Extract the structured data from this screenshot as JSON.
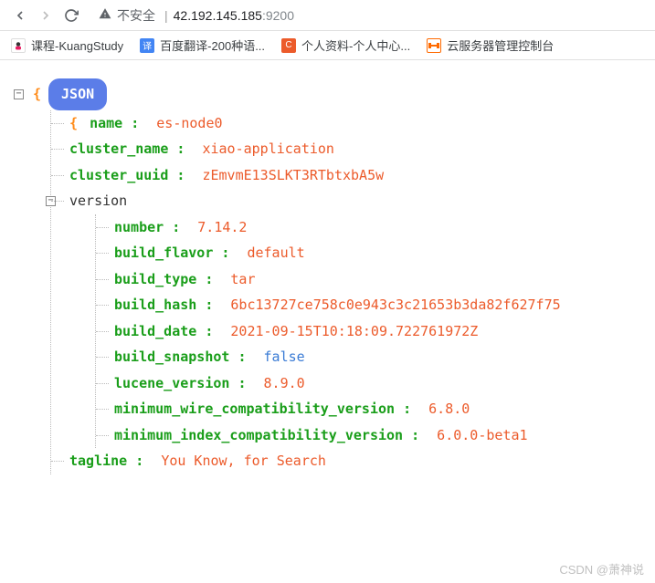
{
  "chrome": {
    "insecure_label": "不安全",
    "url_host": "42.192.145.185",
    "url_port": ":9200"
  },
  "bookmarks": [
    {
      "label": "课程-KuangStudy"
    },
    {
      "label": "百度翻译-200种语..."
    },
    {
      "label": "个人资料-个人中心..."
    },
    {
      "label": "云服务器管理控制台"
    }
  ],
  "json": {
    "badge": "JSON",
    "fields": {
      "name_key": "name",
      "name_val": "es-node0",
      "cluster_name_key": "cluster_name",
      "cluster_name_val": "xiao-application",
      "cluster_uuid_key": "cluster_uuid",
      "cluster_uuid_val": "zEmvmE13SLKT3RTbtxbA5w",
      "version_key": "version",
      "tagline_key": "tagline",
      "tagline_val": "You Know, for Search"
    },
    "version": {
      "number_key": "number",
      "number_val": "7.14.2",
      "build_flavor_key": "build_flavor",
      "build_flavor_val": "default",
      "build_type_key": "build_type",
      "build_type_val": "tar",
      "build_hash_key": "build_hash",
      "build_hash_val": "6bc13727ce758c0e943c3c21653b3da82f627f75",
      "build_date_key": "build_date",
      "build_date_val": "2021-09-15T10:18:09.722761972Z",
      "build_snapshot_key": "build_snapshot",
      "build_snapshot_val": "false",
      "lucene_version_key": "lucene_version",
      "lucene_version_val": "8.9.0",
      "min_wire_key": "minimum_wire_compatibility_version",
      "min_wire_val": "6.8.0",
      "min_index_key": "minimum_index_compatibility_version",
      "min_index_val": "6.0.0-beta1"
    }
  },
  "watermark": "CSDN @萧神说"
}
